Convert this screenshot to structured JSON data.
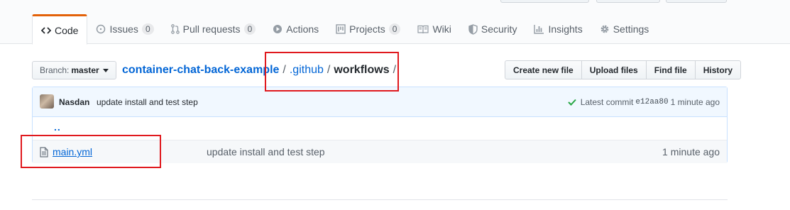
{
  "tabs": [
    {
      "label": "Code",
      "icon": "code-icon",
      "selected": true
    },
    {
      "label": "Issues",
      "icon": "issue-icon",
      "count": "0"
    },
    {
      "label": "Pull requests",
      "icon": "pull-request-icon",
      "count": "0"
    },
    {
      "label": "Actions",
      "icon": "play-icon"
    },
    {
      "label": "Projects",
      "icon": "project-icon",
      "count": "0"
    },
    {
      "label": "Wiki",
      "icon": "book-icon"
    },
    {
      "label": "Security",
      "icon": "shield-icon"
    },
    {
      "label": "Insights",
      "icon": "graph-icon"
    },
    {
      "label": "Settings",
      "icon": "gear-icon"
    }
  ],
  "branch": {
    "label": "Branch:",
    "value": "master"
  },
  "breadcrumb": {
    "repo": "container-chat-back-example",
    "folder": ".github",
    "current": "workflows",
    "sep": "/"
  },
  "actions": {
    "create": "Create new file",
    "upload": "Upload files",
    "find": "Find file",
    "history": "History"
  },
  "commit": {
    "author": "Nasdan",
    "message": "update install and test step",
    "latest_label": "Latest commit",
    "sha": "e12aa80",
    "age": "1 minute ago"
  },
  "files": {
    "up_dir": "..",
    "rows": [
      {
        "name": "main.yml",
        "message": "update install and test step",
        "age": "1 minute ago"
      }
    ]
  },
  "colors": {
    "accent": "#e36209",
    "link": "#0366d6",
    "annotation": "#e0191e",
    "success": "#28a745"
  }
}
